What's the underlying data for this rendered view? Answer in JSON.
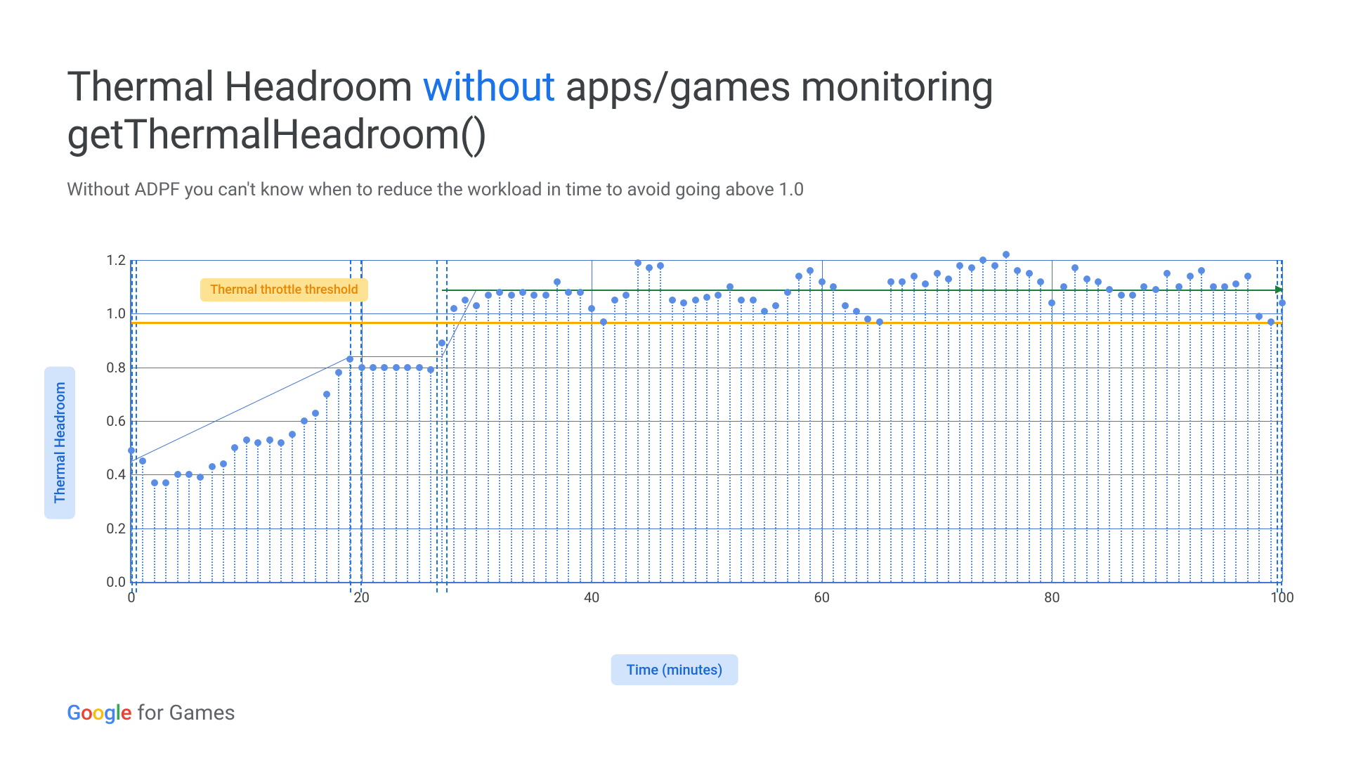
{
  "title": {
    "pre": "Thermal Headroom ",
    "highlight": "without",
    "post": " apps/games monitoring getThermalHeadroom()"
  },
  "subtitle": "Without ADPF you can't know when to reduce the workload in time to avoid going above 1.0",
  "axis": {
    "x": "Time (minutes)",
    "y": "Thermal Headroom"
  },
  "threshold_label": "Thermal throttle threshold",
  "logo_tail": "for Games",
  "chart_data": {
    "type": "scatter",
    "title": "Thermal Headroom without apps/games monitoring getThermalHeadroom()",
    "xlabel": "Time (minutes)",
    "ylabel": "Thermal Headroom",
    "xlim": [
      0,
      100
    ],
    "ylim": [
      0.0,
      1.2
    ],
    "xticks": [
      0,
      20,
      40,
      60,
      80,
      100
    ],
    "yticks": [
      0.0,
      0.2,
      0.4,
      0.6,
      0.8,
      1.0,
      1.2
    ],
    "annotations": [
      {
        "type": "hline",
        "y": 0.97,
        "label": "Thermal throttle threshold",
        "color": "#f9ab00"
      },
      {
        "type": "hline_partial",
        "y": 1.09,
        "x0": 27,
        "x1": 100,
        "color": "#188038",
        "arrow": "right"
      }
    ],
    "dashed_x_regions": [
      [
        0,
        0.5
      ],
      [
        19,
        20
      ],
      [
        26.5,
        27.5
      ],
      [
        99.5,
        100
      ]
    ],
    "trend_segments": [
      {
        "x0": 0,
        "y0": 0.45,
        "x1": 19,
        "y1": 0.84
      },
      {
        "x0": 19,
        "y0": 0.84,
        "x1": 27,
        "y1": 0.84
      },
      {
        "x0": 27,
        "y0": 0.84,
        "x1": 30,
        "y1": 1.09
      }
    ],
    "x": [
      0,
      1,
      2,
      3,
      4,
      5,
      6,
      7,
      8,
      9,
      10,
      11,
      12,
      13,
      14,
      15,
      16,
      17,
      18,
      19,
      20,
      21,
      22,
      23,
      24,
      25,
      26,
      27,
      28,
      29,
      30,
      31,
      32,
      33,
      34,
      35,
      36,
      37,
      38,
      39,
      40,
      41,
      42,
      43,
      44,
      45,
      46,
      47,
      48,
      49,
      50,
      51,
      52,
      53,
      54,
      55,
      56,
      57,
      58,
      59,
      60,
      61,
      62,
      63,
      64,
      65,
      66,
      67,
      68,
      69,
      70,
      71,
      72,
      73,
      74,
      75,
      76,
      77,
      78,
      79,
      80,
      81,
      82,
      83,
      84,
      85,
      86,
      87,
      88,
      89,
      90,
      91,
      92,
      93,
      94,
      95,
      96,
      97,
      98,
      99,
      100
    ],
    "y": [
      0.49,
      0.45,
      0.37,
      0.37,
      0.4,
      0.4,
      0.39,
      0.43,
      0.44,
      0.5,
      0.53,
      0.52,
      0.53,
      0.52,
      0.55,
      0.6,
      0.63,
      0.7,
      0.78,
      0.83,
      0.8,
      0.8,
      0.8,
      0.8,
      0.8,
      0.8,
      0.79,
      0.89,
      1.02,
      1.05,
      1.03,
      1.07,
      1.08,
      1.07,
      1.08,
      1.07,
      1.07,
      1.12,
      1.08,
      1.08,
      1.02,
      0.97,
      1.05,
      1.07,
      1.19,
      1.17,
      1.18,
      1.05,
      1.04,
      1.05,
      1.06,
      1.07,
      1.1,
      1.05,
      1.05,
      1.01,
      1.03,
      1.08,
      1.14,
      1.16,
      1.12,
      1.1,
      1.03,
      1.01,
      0.98,
      0.97,
      1.12,
      1.12,
      1.14,
      1.11,
      1.15,
      1.13,
      1.18,
      1.17,
      1.2,
      1.18,
      1.22,
      1.16,
      1.15,
      1.12,
      1.04,
      1.1,
      1.17,
      1.13,
      1.12,
      1.09,
      1.07,
      1.07,
      1.1,
      1.09,
      1.15,
      1.1,
      1.14,
      1.16,
      1.1,
      1.1,
      1.11,
      1.14,
      0.99,
      0.97,
      1.04
    ]
  }
}
